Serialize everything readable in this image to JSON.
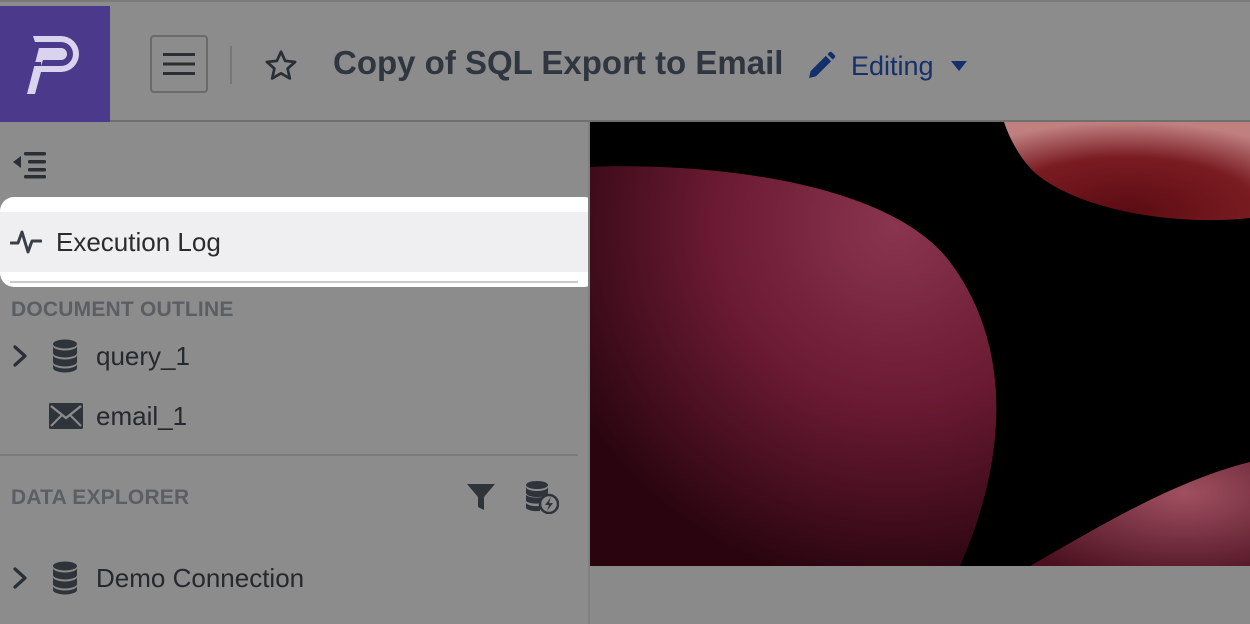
{
  "header": {
    "title": "Copy of SQL Export to Email",
    "mode_label": "Editing"
  },
  "sidebar": {
    "execution_log_label": "Execution Log",
    "outline_title": "DOCUMENT OUTLINE",
    "outline_items": [
      {
        "label": "query_1",
        "icon": "database-icon",
        "expandable": true
      },
      {
        "label": "email_1",
        "icon": "envelope-icon",
        "expandable": false
      }
    ],
    "explorer_title": "DATA EXPLORER",
    "explorer_items": [
      {
        "label": "Demo Connection",
        "icon": "database-icon",
        "expandable": true
      }
    ]
  },
  "colors": {
    "logo_bg": "#4b3a8c",
    "mode_text": "#14306b",
    "highlight_bg": "#efeff1",
    "highlight_accent": "#d7263d"
  },
  "icons": [
    "logo-icon",
    "hamburger-icon",
    "star-icon",
    "pencil-icon",
    "caret-down-icon",
    "collapse-sidebar-icon",
    "activity-icon",
    "chevron-right-icon",
    "database-icon",
    "envelope-icon",
    "filter-icon",
    "database-bolt-icon"
  ]
}
